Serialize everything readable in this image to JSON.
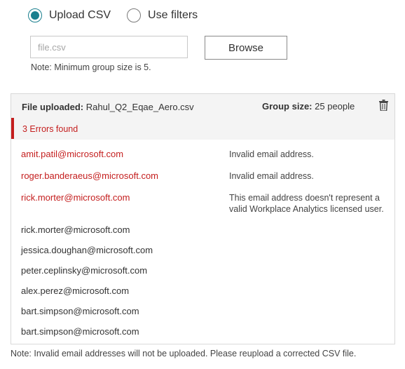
{
  "mode_options": {
    "upload_csv": {
      "label": "Upload CSV",
      "selected": true
    },
    "use_filters": {
      "label": "Use filters",
      "selected": false
    }
  },
  "file_input": {
    "value": "",
    "placeholder": "file.csv"
  },
  "browse_button": {
    "label": "Browse"
  },
  "min_group_note": "Note: Minimum group size is 5.",
  "panel": {
    "file_uploaded_label": "File uploaded:",
    "file_name": "Rahul_Q2_Eqae_Aero.csv",
    "group_size_label": "Group size:",
    "group_size_value": "25 people",
    "errors_text": "3 Errors found",
    "rows": [
      {
        "email": "amit.patil@microsoft.com",
        "error": true,
        "message": "Invalid email address."
      },
      {
        "email": "roger.banderaeus@microsoft.com",
        "error": true,
        "message": "Invalid email address."
      },
      {
        "email": "rick.morter@microsoft.com",
        "error": true,
        "message": "This email address doesn't represent a valid Workplace Analytics licensed user."
      },
      {
        "email": "rick.morter@microsoft.com",
        "error": false,
        "message": ""
      },
      {
        "email": "jessica.doughan@microsoft.com",
        "error": false,
        "message": ""
      },
      {
        "email": "peter.ceplinsky@microsoft.com",
        "error": false,
        "message": ""
      },
      {
        "email": "alex.perez@microsoft.com",
        "error": false,
        "message": ""
      },
      {
        "email": "bart.simpson@microsoft.com",
        "error": false,
        "message": ""
      },
      {
        "email": "bart.simpson@microsoft.com",
        "error": false,
        "message": ""
      }
    ]
  },
  "bottom_note": "Note: Invalid email addresses will not be uploaded. Please reupload a corrected CSV file.",
  "colors": {
    "accent": "#1a7f8e",
    "error": "#c41e1e"
  },
  "icons": {
    "delete": "trash-icon"
  }
}
